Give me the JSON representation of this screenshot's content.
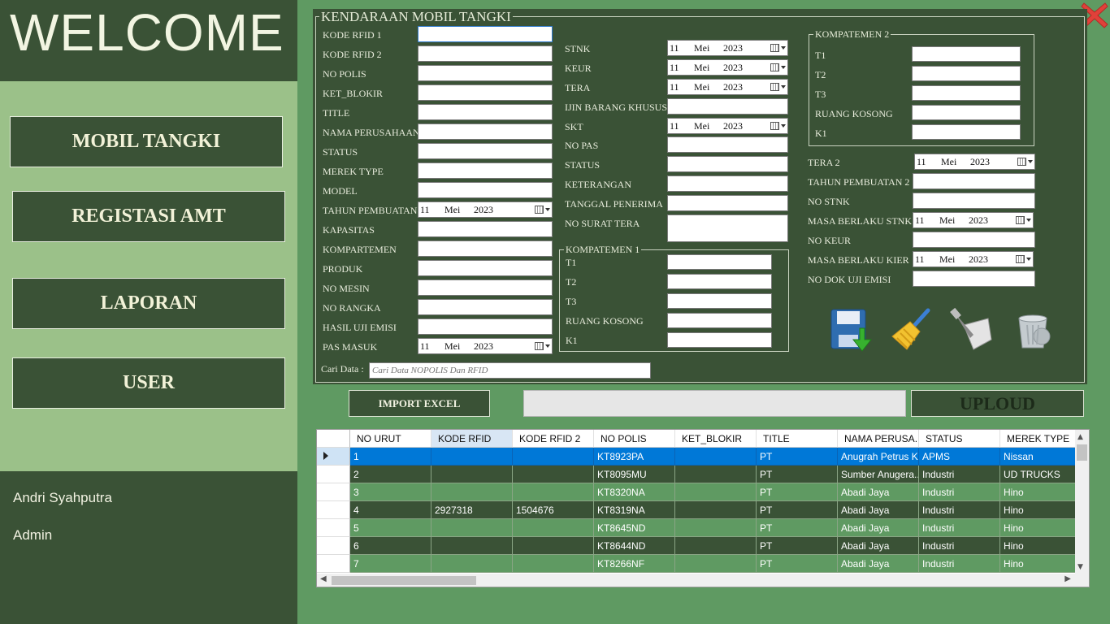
{
  "sidebar": {
    "welcome": "WELCOME",
    "nav": [
      "MOBIL TANGKI",
      "REGISTASI AMT",
      "LAPORAN",
      "USER"
    ],
    "user_name": "Andri Syahputra",
    "user_role": "Admin"
  },
  "form": {
    "title": "KENDARAAN MOBIL TANGKI",
    "left": {
      "kode_rfid1": "KODE RFID 1",
      "kode_rfid2": "KODE RFID 2",
      "no_polis": "NO POLIS",
      "ket_blokir": "KET_BLOKIR",
      "title": "TITLE",
      "nama_perusahaan": "NAMA PERUSAHAAN",
      "status": "STATUS",
      "merek_type": "MEREK TYPE",
      "model": "MODEL",
      "tahun_pembuatan": "TAHUN PEMBUATAN",
      "kapasitas": "KAPASITAS",
      "kompartemen": "KOMPARTEMEN",
      "produk": "PRODUK",
      "no_mesin": "NO MESIN",
      "no_rangka": "NO RANGKA",
      "hasil_uji_emisi": "HASIL UJI EMISI",
      "pas_masuk": "PAS MASUK"
    },
    "middle": {
      "stnk": "STNK",
      "keur": "KEUR",
      "tera": "TERA",
      "ijin": "IJIN BARANG KHUSUS",
      "skt": "SKT",
      "no_pas": "NO PAS",
      "status": "STATUS",
      "keterangan": "KETERANGAN",
      "tanggal_penerima": "TANGGAL PENERIMA",
      "no_surat_tera": "NO SURAT TERA"
    },
    "komp1": {
      "title": "KOMPATEMEN 1",
      "t1": "T1",
      "t2": "T2",
      "t3": "T3",
      "ruang": "RUANG KOSONG",
      "k1": "K1"
    },
    "komp2": {
      "title": "KOMPATEMEN 2",
      "t1": "T1",
      "t2": "T2",
      "t3": "T3",
      "ruang": "RUANG KOSONG",
      "k1": "K1"
    },
    "right": {
      "tera2": "TERA 2",
      "tahun2": "TAHUN PEMBUATAN 2",
      "no_stnk": "NO STNK",
      "masa_stnk": "MASA BERLAKU STNK",
      "no_keur": "NO KEUR",
      "masa_kier": "MASA BERLAKU KIER",
      "no_dok": "NO DOK UJI EMISI"
    },
    "date": {
      "day": "11",
      "month": "Mei",
      "year": "2023"
    },
    "search_label": "Cari Data :",
    "search_placeholder": "Cari Data NOPOLIS Dan RFID",
    "icons": [
      "save-icon",
      "broom-clear-icon",
      "edit-icon",
      "recycle-bin-icon"
    ]
  },
  "buttons": {
    "import": "IMPORT EXCEL",
    "upload": "UPLOUD"
  },
  "grid": {
    "columns": [
      "NO URUT",
      "KODE RFID",
      "KODE RFID 2",
      "NO POLIS",
      "KET_BLOKIR",
      "TITLE",
      "NAMA PERUSA...",
      "STATUS",
      "MEREK TYPE"
    ],
    "rows": [
      [
        "1",
        "",
        "",
        "KT8923PA",
        "",
        "PT",
        "Anugrah Petrus K...",
        "APMS",
        "Nissan"
      ],
      [
        "2",
        "",
        "",
        "KT8095MU",
        "",
        "PT",
        "Sumber Anugera...",
        "Industri",
        "UD TRUCKS"
      ],
      [
        "3",
        "",
        "",
        "KT8320NA",
        "",
        "PT",
        "Abadi Jaya",
        "Industri",
        "Hino"
      ],
      [
        "4",
        "2927318",
        "1504676",
        "KT8319NA",
        "",
        "PT",
        "Abadi Jaya",
        "Industri",
        "Hino"
      ],
      [
        "5",
        "",
        "",
        "KT8645ND",
        "",
        "PT",
        "Abadi Jaya",
        "Industri",
        "Hino"
      ],
      [
        "6",
        "",
        "",
        "KT8644ND",
        "",
        "PT",
        "Abadi Jaya",
        "Industri",
        "Hino"
      ],
      [
        "7",
        "",
        "",
        "KT8266NF",
        "",
        "PT",
        "Abadi Jaya",
        "Industri",
        "Hino"
      ]
    ],
    "selected_row": 1,
    "colors": {
      "selected": "#0078d7",
      "dark_row": "#3a5236",
      "light_row": "#5f9a62"
    }
  }
}
